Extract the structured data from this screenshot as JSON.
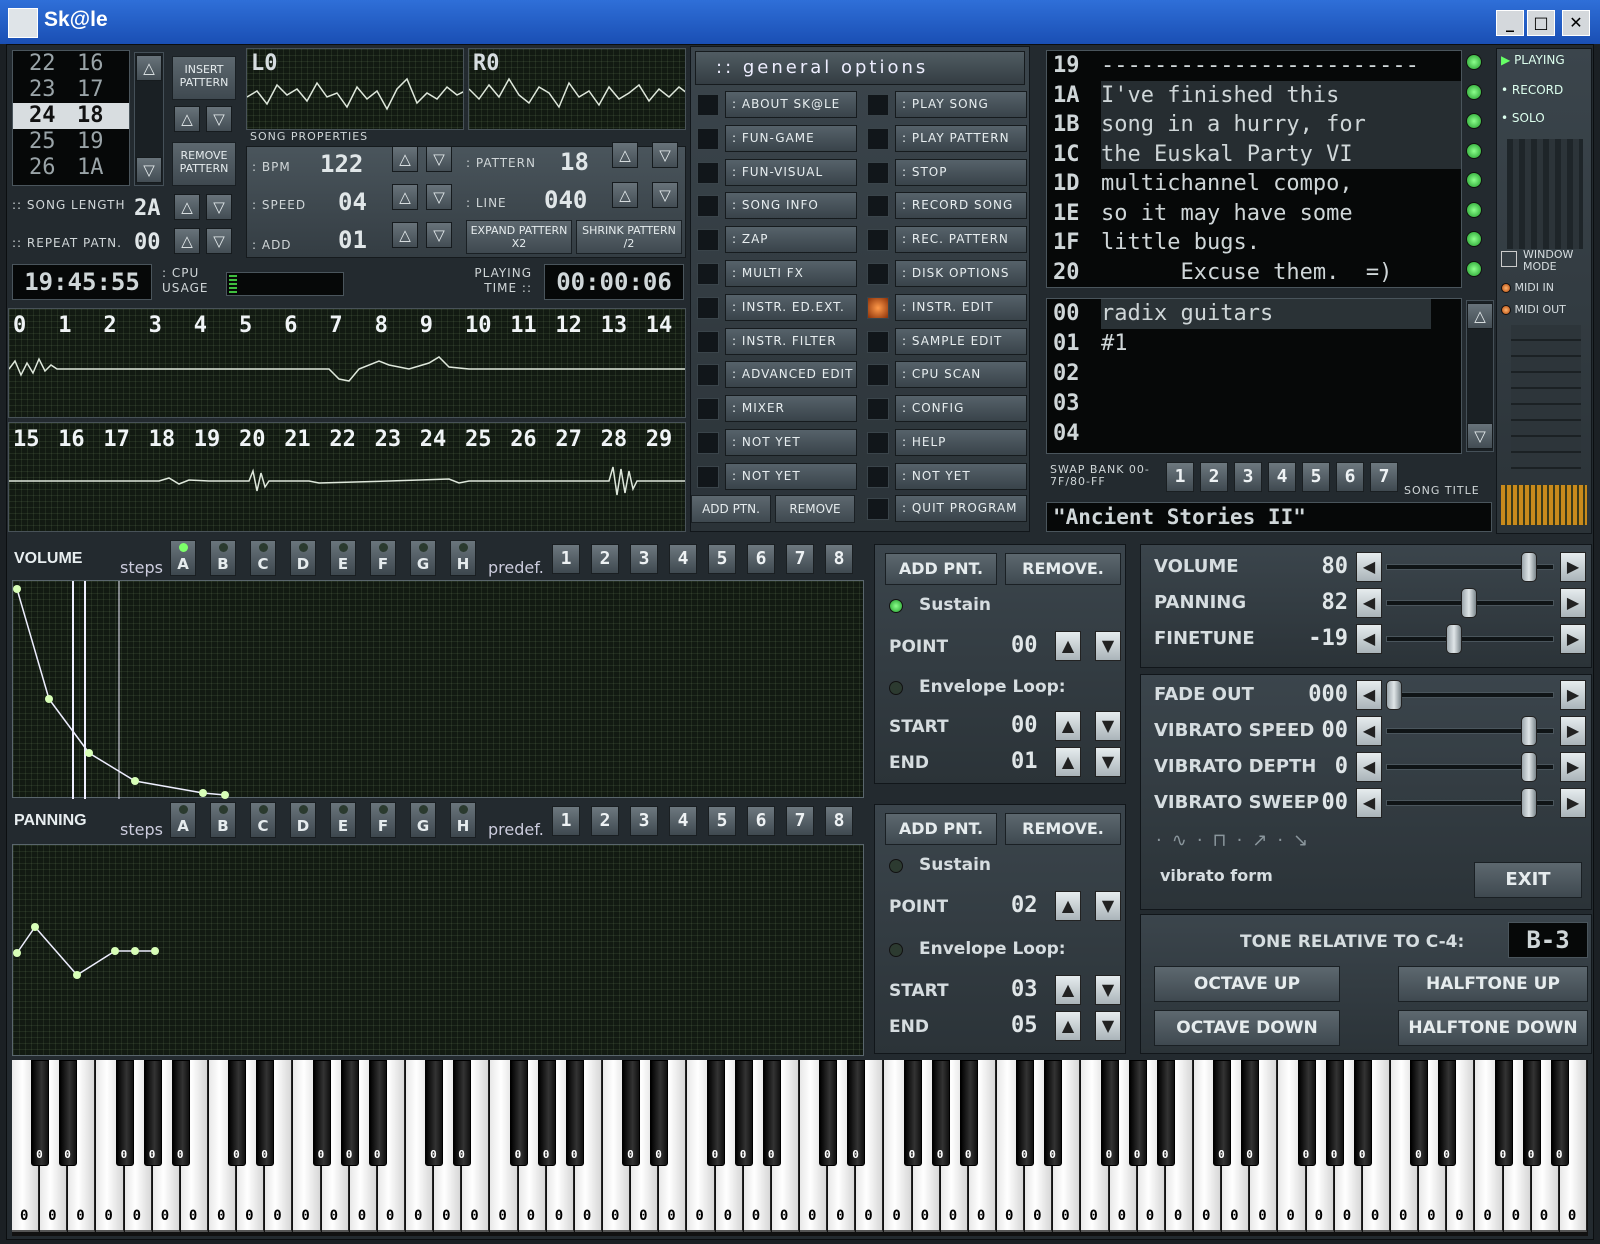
{
  "window": {
    "title": "Sk@le",
    "controls": [
      "_",
      "□",
      "✕"
    ]
  },
  "patterns_list": {
    "rows": [
      [
        "22",
        "16"
      ],
      [
        "23",
        "17"
      ],
      [
        "24",
        "18"
      ],
      [
        "25",
        "19"
      ],
      [
        "26",
        "1A"
      ]
    ],
    "selected_index": 2
  },
  "pattern_buttons": {
    "insert": "INSERT PATTERN",
    "remove": "REMOVE PATTERN"
  },
  "song_length": {
    "label": ":: SONG LENGTH",
    "value": "2A"
  },
  "repeat_patn": {
    "label": ":: REPEAT PATN.",
    "value": "00"
  },
  "scopes": {
    "left": "L0",
    "right": "R0"
  },
  "song_properties": {
    "title": "SONG PROPERTIES",
    "bpm": {
      "label": ": BPM",
      "value": "122"
    },
    "speed": {
      "label": ": SPEED",
      "value": "04"
    },
    "add": {
      "label": ": ADD",
      "value": "01"
    },
    "pattern": {
      "label": ": PATTERN",
      "value": "18"
    },
    "line": {
      "label": ": LINE",
      "value": "040"
    },
    "expand": "EXPAND PATTERN X2",
    "shrink": "SHRINK PATTERN /2"
  },
  "clock": "19:45:55",
  "cpu": {
    "label": ": CPU USAGE"
  },
  "playing_time": {
    "label": "PLAYING TIME ::",
    "value": "00:00:06"
  },
  "channels_row1": [
    "0",
    "1",
    "2",
    "3",
    "4",
    "5",
    "6",
    "7",
    "8",
    "9",
    "10",
    "11",
    "12",
    "13",
    "14"
  ],
  "channels_row2": [
    "15",
    "16",
    "17",
    "18",
    "19",
    "20",
    "21",
    "22",
    "23",
    "24",
    "25",
    "26",
    "27",
    "28",
    "29"
  ],
  "general_options": {
    "title": ":: general options",
    "left": [
      ": ABOUT SK@LE",
      ": FUN-GAME",
      ": FUN-VISUAL",
      ": SONG INFO",
      ": ZAP",
      ": MULTI FX",
      ": INSTR. ED.EXT.",
      ": INSTR. FILTER",
      ": ADVANCED EDIT",
      ": MIXER",
      ": NOT YET",
      ": NOT YET"
    ],
    "right": [
      ": PLAY SONG",
      ": PLAY PATTERN",
      ": STOP",
      ": RECORD SONG",
      ": REC. PATTERN",
      ": DISK OPTIONS",
      ": INSTR. EDIT",
      ": SAMPLE EDIT",
      ": CPU SCAN",
      ": CONFIG",
      ": HELP",
      ": NOT YET"
    ],
    "add_ptn": "ADD PTN.",
    "remove": "REMOVE",
    "quit": ": QUIT PROGRAM"
  },
  "song_info": {
    "line_numbers": [
      "19",
      "1A",
      "1B",
      "1C",
      "1D",
      "1E",
      "1F",
      "20"
    ],
    "lines": [
      "------------------------",
      "I've finished this",
      "song in a hurry, for",
      "the Euskal Party VI",
      "multichannel compo,",
      "so it may have some",
      "little bugs.",
      "      Excuse them.  =)"
    ]
  },
  "transport": {
    "playing": "PLAYING",
    "record": "RECORD",
    "solo": "SOLO",
    "window_mode": "WINDOW MODE",
    "midi_in": "MIDI IN",
    "midi_out": "MIDI OUT"
  },
  "instruments": {
    "numbers": [
      "00",
      "01",
      "02",
      "03",
      "04"
    ],
    "names": [
      "radix guitars",
      "#1",
      "",
      "",
      ""
    ]
  },
  "swap_bank": {
    "label": "SWAP BANK 00-7F/80-FF",
    "banks": [
      "1",
      "2",
      "3",
      "4",
      "5",
      "6",
      "7"
    ]
  },
  "song_title": {
    "label": "SONG TITLE",
    "value": "\"Ancient Stories II\""
  },
  "volume_env": {
    "title": "VOLUME",
    "steps_label": "steps",
    "steps": [
      "A",
      "B",
      "C",
      "D",
      "E",
      "F",
      "G",
      "H"
    ],
    "active_step": 0,
    "predef_label": "predef.",
    "predef": [
      "1",
      "2",
      "3",
      "4",
      "5",
      "6",
      "7",
      "8"
    ],
    "add": "ADD PNT.",
    "remove": "REMOVE.",
    "sustain": "Sustain",
    "point_label": "POINT",
    "point": "00",
    "loop": "Envelope Loop:",
    "start_label": "START",
    "start": "00",
    "end_label": "END",
    "end": "01"
  },
  "panning_env": {
    "title": "PANNING",
    "steps_label": "steps",
    "steps": [
      "A",
      "B",
      "C",
      "D",
      "E",
      "F",
      "G",
      "H"
    ],
    "predef_label": "predef.",
    "predef": [
      "1",
      "2",
      "3",
      "4",
      "5",
      "6",
      "7",
      "8"
    ],
    "add": "ADD PNT.",
    "remove": "REMOVE.",
    "sustain": "Sustain",
    "point_label": "POINT",
    "point": "02",
    "loop": "Envelope Loop:",
    "start_label": "START",
    "start": "03",
    "end_label": "END",
    "end": "05"
  },
  "instrument_params": {
    "volume": {
      "label": "VOLUME",
      "value": "80",
      "level": 0.9
    },
    "panning": {
      "label": "PANNING",
      "value": "82",
      "level": 0.5
    },
    "finetune": {
      "label": "FINETUNE",
      "value": "-19",
      "level": 0.4
    },
    "fade_out": {
      "label": "FADE OUT",
      "value": "000",
      "level": 0.0
    },
    "vibrato_speed": {
      "label": "VIBRATO SPEED",
      "value": "00",
      "level": 0.9
    },
    "vibrato_depth": {
      "label": "VIBRATO DEPTH",
      "value": "0",
      "level": 0.9
    },
    "vibrato_sweep": {
      "label": "VIBRATO SWEEP",
      "value": "00",
      "level": 0.9
    },
    "vibrato_form": "vibrato form",
    "exit": "EXIT"
  },
  "tone": {
    "label": "TONE RELATIVE TO C-4:",
    "value": "B-3",
    "octave_up": "OCTAVE UP",
    "octave_down": "OCTAVE DOWN",
    "halftone_up": "HALFTONE UP",
    "halftone_down": "HALFTONE DOWN"
  },
  "piano": {
    "white_label": "0",
    "black_label": "0",
    "white_keys": 56
  }
}
